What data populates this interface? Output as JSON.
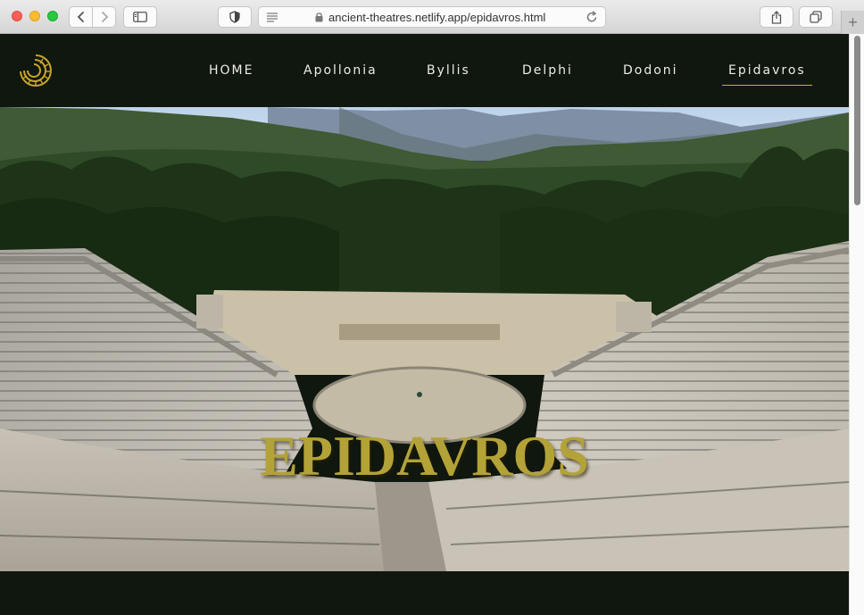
{
  "browser": {
    "url": "ancient-theatres.netlify.app/epidavros.html",
    "icons": {
      "back": "chevron-left-icon",
      "forward": "chevron-right-icon",
      "sidebar": "sidebar-icon",
      "privacy": "shield-icon",
      "reader": "reader-icon",
      "lock": "lock-icon",
      "reload": "reload-icon",
      "share": "share-icon",
      "tabs": "tabs-icon",
      "new_tab": "plus-icon"
    },
    "new_tab_label": "+"
  },
  "site": {
    "logo": "sun-arc-logo",
    "nav": [
      {
        "label": "HOME",
        "active": false
      },
      {
        "label": "Apollonia",
        "active": false
      },
      {
        "label": "Byllis",
        "active": false
      },
      {
        "label": "Delphi",
        "active": false
      },
      {
        "label": "Dodoni",
        "active": false
      },
      {
        "label": "Epidavros",
        "active": true
      }
    ],
    "hero_title": "EPIDAVROS"
  },
  "colors": {
    "page_bg": "#0f170f",
    "accent_gold": "#c9b13a",
    "hero_title": "#b3a238",
    "nav_text": "#ecece4"
  }
}
